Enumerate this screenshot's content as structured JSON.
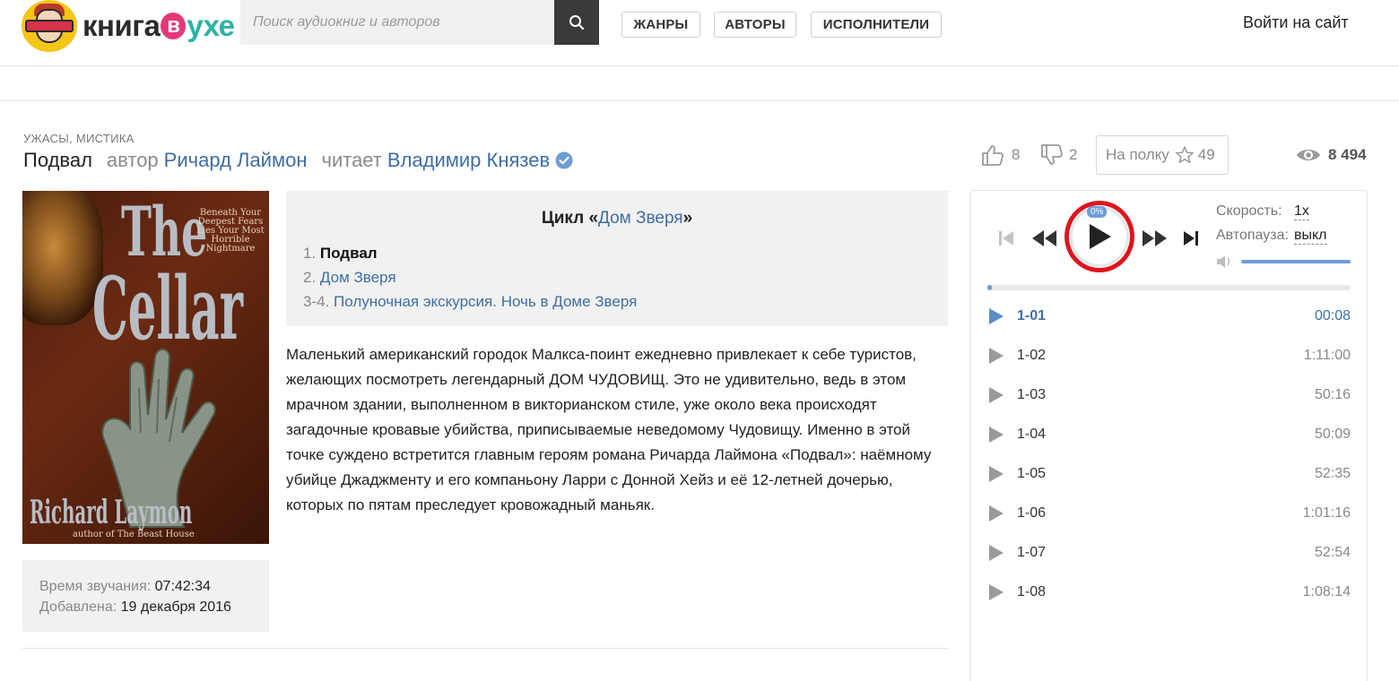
{
  "header": {
    "logo": {
      "part1": "книга",
      "letter": "в",
      "part2": "ухе"
    },
    "search": {
      "placeholder": "Поиск аудиокниг и авторов"
    },
    "nav": [
      "ЖАНРЫ",
      "АВТОРЫ",
      "ИСПОЛНИТЕЛИ"
    ],
    "login": "Войти на сайт"
  },
  "book": {
    "genres": "УЖАСЫ, МИСТИКА",
    "title": "Подвал",
    "author_prefix": "автор",
    "author": "Ричард Лаймон",
    "reader_prefix": "читает",
    "reader": "Владимир Князев",
    "likes": "8",
    "dislikes": "2",
    "shelf_label": "На полку",
    "shelf_count": "49",
    "views": "8 494"
  },
  "cover": {
    "word1": "The",
    "word2": "Cellar",
    "tagline": "Beneath Your Deepest Fears Lies Your Most Horrible Nightmare",
    "author": "Richard Laymon",
    "subtitle": "author of The Beast House"
  },
  "info": {
    "duration_label": "Время звучания:",
    "duration": "07:42:34",
    "added_label": "Добавлена:",
    "added": "19 декабря 2016"
  },
  "series": {
    "prefix": "Цикл «",
    "name": "Дом Зверя",
    "suffix": "»",
    "items": [
      {
        "num": "1.",
        "title": "Подвал"
      },
      {
        "num": "2.",
        "title": "Дом Зверя"
      },
      {
        "num": "3-4.",
        "title": "Полуночная экскурсия. Ночь в Доме Зверя"
      }
    ]
  },
  "description": "Маленький американский городок Малкса-поинт ежедневно привлекает к себе туристов, желающих посмотреть легендарный ДОМ ЧУДОВИЩ. Это не удивительно, ведь в этом мрачном здании, выполненном в викторианском стиле, уже около века происходят загадочные кровавые убийства, приписываемые неведомому Чудовищу. Именно в этой точке суждено встретится главным героям романа Ричарда Лаймона «Подвал»: наёмному убийце Джаджменту и его компаньону Ларри с Донной Хейз и её 12-летней дочерью, которых по пятам преследует кровожадный маньяк.",
  "player": {
    "percent": "0%",
    "speed_label": "Скорость:",
    "speed": "1x",
    "autopause_label": "Автопауза:",
    "autopause": "выкл",
    "volume": 1.0,
    "progress": 0.0,
    "tracks": [
      {
        "name": "1-01",
        "duration": "00:08"
      },
      {
        "name": "1-02",
        "duration": "1:11:00"
      },
      {
        "name": "1-03",
        "duration": "50:16"
      },
      {
        "name": "1-04",
        "duration": "50:09"
      },
      {
        "name": "1-05",
        "duration": "52:35"
      },
      {
        "name": "1-06",
        "duration": "1:01:16"
      },
      {
        "name": "1-07",
        "duration": "52:54"
      },
      {
        "name": "1-08",
        "duration": "1:08:14"
      }
    ]
  },
  "colors": {
    "link": "#3f6ea5",
    "accent": "#6f9cd6",
    "highlight_ring": "#e0141e",
    "logo_yellow": "#f5c518",
    "logo_pink": "#e5387a",
    "logo_teal": "#2bb3a3"
  }
}
